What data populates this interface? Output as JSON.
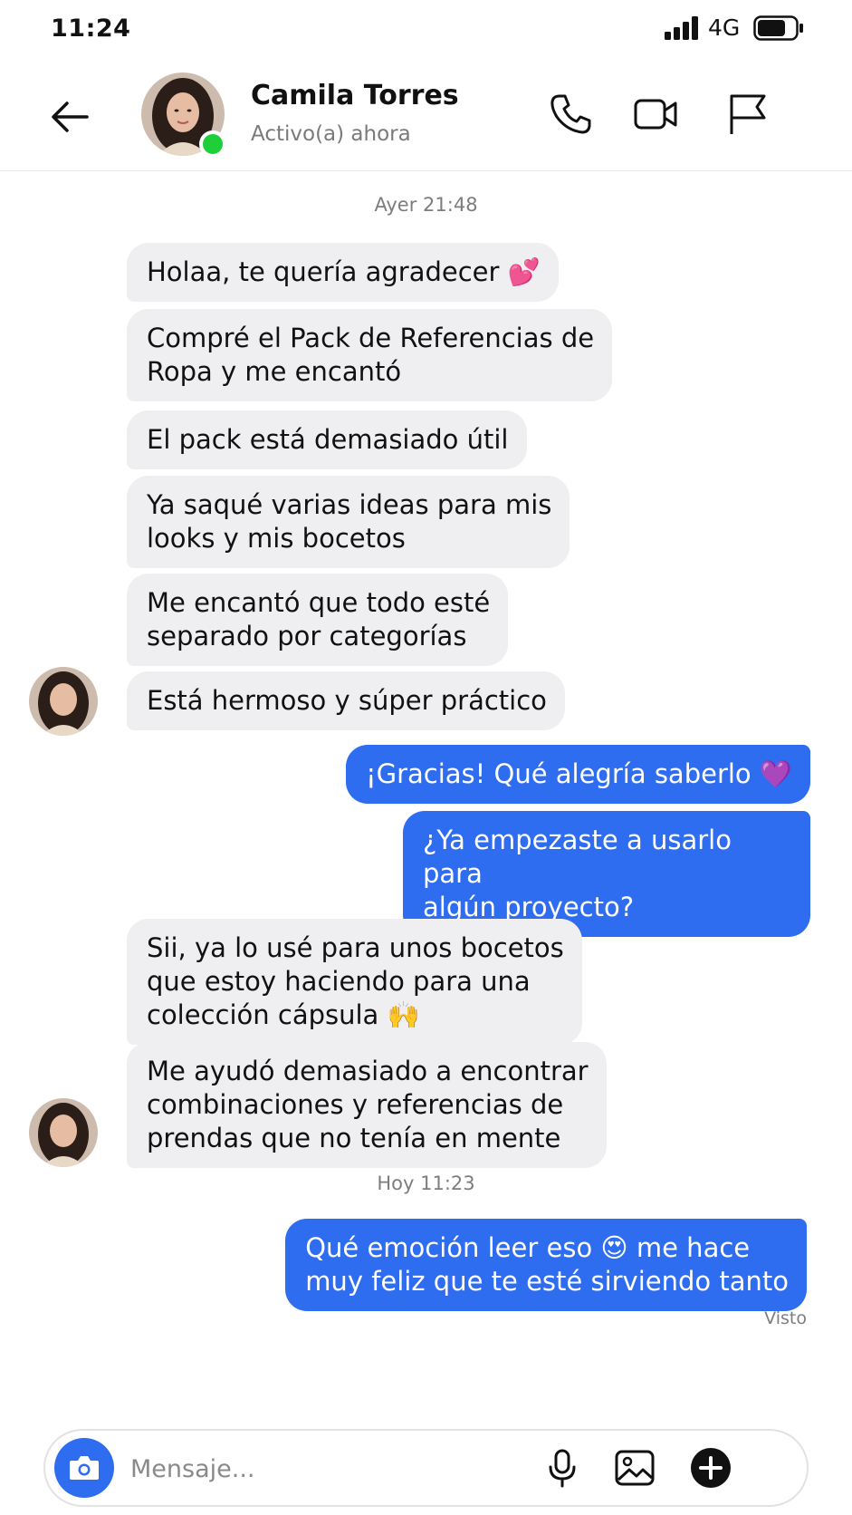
{
  "status_bar": {
    "time": "11:24",
    "network": "4G",
    "battery_level": 0.75
  },
  "header": {
    "name": "Camila Torres",
    "status": "Activo(a) ahora",
    "online_color": "#1fcf3a",
    "icons": [
      "back-arrow-icon",
      "phone-icon",
      "video-camera-icon",
      "flag-icon"
    ]
  },
  "chat": {
    "timestamp_1": "Ayer 21:48",
    "incoming_group_1": [
      "Holaa, te quería agradecer 💕",
      "Compré el Pack de Referencias de\nRopa y me encantó",
      "El pack está demasiado útil",
      "Ya saqué varias ideas para mis\nlooks y mis bocetos",
      "Me encantó que todo esté\nseparado por categorías",
      "Está hermoso y súper práctico"
    ],
    "outgoing_group_1": [
      "¡Gracias! Qué alegría saberlo 💜",
      "¿Ya empezaste a usarlo para\nalgún proyecto?"
    ],
    "incoming_group_2": [
      "Sii, ya lo usé para unos bocetos\nque estoy haciendo para una\ncolección cápsula 🙌",
      "Me ayudó demasiado a encontrar\ncombinaciones y referencias de\nprendas que no tenía en mente"
    ],
    "timestamp_2": "Hoy 11:23",
    "outgoing_group_2": [
      "Qué emoción leer eso 😍 me hace\nmuy feliz que te esté sirviendo tanto"
    ],
    "seen_label": "Visto",
    "colors": {
      "outgoing_bubble": "#2e6cf0",
      "incoming_bubble": "#efeff1"
    }
  },
  "composer": {
    "placeholder": "Mensaje...",
    "icons": [
      "camera-icon",
      "microphone-icon",
      "gallery-icon",
      "plus-icon"
    ]
  }
}
